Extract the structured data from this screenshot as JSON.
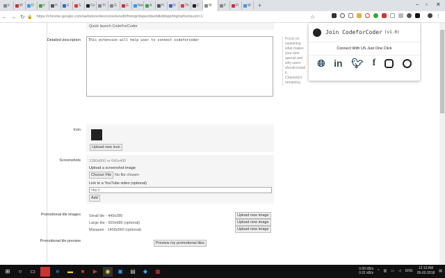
{
  "browser": {
    "tabs": [
      "Ir",
      "W",
      "D",
      "Ir",
      "H",
      "S",
      "S",
      "Co",
      "Yt",
      "G",
      "G",
      "New",
      "A",
      "H",
      "N",
      "Th",
      "C",
      "W",
      "F",
      "Fi",
      "W"
    ],
    "active_tab_index": 17,
    "new_tab": "+",
    "url": "https://chrome.google.com/webstore/devconsole/edit/fmmgmfapecbbelldkdkbpphhgmpfoxhiusm=1"
  },
  "form": {
    "short_description": "Quick launch CodeForCoder",
    "detailed_label": "Detailed description",
    "detailed_value": "This extension will help user to connect codeforcoder",
    "side_hint_1": "Focus on explaining what makes your item special and why users should install it.",
    "side_hint_2": "Characters remaining",
    "icon_label": "Icon",
    "upload_icon": "Upload new icon",
    "screenshots_label": "Screenshots",
    "screenshot_sizes": "1280x800 or 640x400",
    "upload_screenshot": "Upload a screenshot image",
    "choose_file": "Choose File",
    "no_file": "No file chosen",
    "youtube_label": "Link to a YouTube video (optional)",
    "youtube_placeholder": "http://",
    "add": "Add",
    "promo_label": "Promotional tile images",
    "promo_rows": [
      {
        "text": "Small tile - 440x280",
        "button": "Upload new image"
      },
      {
        "text": "Large tile - 920x680 (optional)",
        "button": "Upload new image"
      },
      {
        "text": "Marquee - 1400x560 (optional)",
        "button": "Upload new image"
      }
    ],
    "promo_preview_label": "Promotional tile preview",
    "preview_button": "Preview my promotional tiles"
  },
  "popup": {
    "title": "Join CodeforCoder",
    "version": "(v1.0)",
    "subtitle": "Connect With US Just One Click",
    "icons": [
      "globe-icon",
      "linkedin-icon",
      "twitter-icon",
      "facebook-icon",
      "instagram-icon",
      "whatsapp-icon"
    ]
  },
  "taskbar": {
    "net_up": "0.00 kB/s",
    "net_down": "0.01 kB/s",
    "lang": "ENG",
    "time": "12:13 AM",
    "date": "05-02-2018"
  }
}
